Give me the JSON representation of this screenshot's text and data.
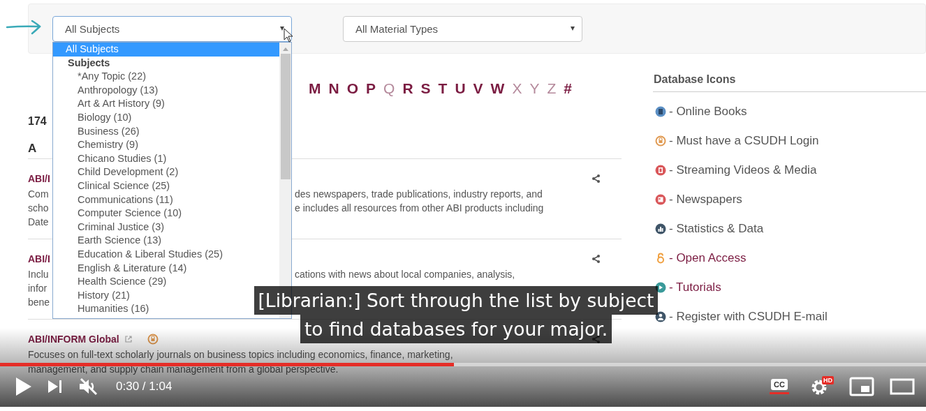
{
  "filters": {
    "subject_select": {
      "value": "All Subjects",
      "expanded": true
    },
    "material_select": {
      "value": "All Material Types"
    }
  },
  "subject_dropdown": {
    "options": [
      {
        "label": "All Subjects",
        "selected": true
      }
    ],
    "groups": [
      {
        "label": "Subjects",
        "options": [
          {
            "label": "*Any Topic (22)",
            "selected": false
          },
          {
            "label": "Anthropology (13)",
            "selected": false
          },
          {
            "label": "Art & Art History (9)",
            "selected": false
          },
          {
            "label": "Biology (10)",
            "selected": false
          },
          {
            "label": "Business (26)",
            "selected": false
          },
          {
            "label": "Chemistry (9)",
            "selected": false
          },
          {
            "label": "Chicano Studies (1)",
            "selected": false
          },
          {
            "label": "Child Development (2)",
            "selected": false
          },
          {
            "label": "Clinical Science (25)",
            "selected": false
          },
          {
            "label": "Communications (11)",
            "selected": false
          },
          {
            "label": "Computer Science (10)",
            "selected": false
          },
          {
            "label": "Criminal Justice (3)",
            "selected": false
          },
          {
            "label": "Earth Science (13)",
            "selected": false
          },
          {
            "label": "Education & Liberal Studies (25)",
            "selected": false
          },
          {
            "label": "English & Literature (14)",
            "selected": false
          },
          {
            "label": "Health Science (29)",
            "selected": false
          },
          {
            "label": "History (21)",
            "selected": false
          },
          {
            "label": "Humanities (16)",
            "selected": false
          }
        ]
      }
    ]
  },
  "alphabet": [
    {
      "letter": "M",
      "disabled": false
    },
    {
      "letter": "N",
      "disabled": false
    },
    {
      "letter": "O",
      "disabled": false
    },
    {
      "letter": "P",
      "disabled": false
    },
    {
      "letter": "Q",
      "disabled": true
    },
    {
      "letter": "R",
      "disabled": false
    },
    {
      "letter": "S",
      "disabled": false
    },
    {
      "letter": "T",
      "disabled": false
    },
    {
      "letter": "U",
      "disabled": false
    },
    {
      "letter": "V",
      "disabled": false
    },
    {
      "letter": "W",
      "disabled": false
    },
    {
      "letter": "X",
      "disabled": true
    },
    {
      "letter": "Y",
      "disabled": true
    },
    {
      "letter": "Z",
      "disabled": true
    },
    {
      "letter": "#",
      "disabled": false
    }
  ],
  "result_count": "174",
  "section_letter": "A",
  "databases": [
    {
      "title": "ABI/I",
      "description": [
        {
          "start": "Com",
          "end": "des newspapers, trade publications, industry reports, and"
        },
        {
          "start": "scho",
          "end": "e includes all resources from other ABI products including"
        },
        {
          "start": "Date"
        }
      ]
    },
    {
      "title": "ABI/I",
      "description": [
        {
          "start": "Inclu",
          "end": "cations with news about local companies, analysis,"
        },
        {
          "start": "infor"
        },
        {
          "start": "bene"
        }
      ]
    },
    {
      "title": "ABI/INFORM Global",
      "external_link": true,
      "login_required": true,
      "description": [
        {
          "text": "Focuses on full-text scholarly journals on business topics including economics, finance, marketing,"
        },
        {
          "text": "management, and supply chain management from a global perspective."
        }
      ]
    }
  ],
  "database_icons": {
    "title": "Database Icons",
    "items": [
      {
        "kind": "text",
        "color": "#5b8fc4",
        "label": "- Online Books"
      },
      {
        "kind": "text",
        "color": "#e09a52",
        "label": "- Must have a CSUDH Login"
      },
      {
        "kind": "text",
        "color": "#d9575a",
        "label": "- Streaming Videos & Media"
      },
      {
        "kind": "text",
        "color": "#d9575a",
        "label": "- Newspapers"
      },
      {
        "kind": "text",
        "color": "#3f5568",
        "label": "- Statistics & Data"
      },
      {
        "kind": "link",
        "color": "#f0a040",
        "label": "- Open Access"
      },
      {
        "kind": "link",
        "color": "#3a9a9a",
        "label": "- Tutorials"
      },
      {
        "kind": "text",
        "color": "#3f5568",
        "label": "- Register with CSUDH E-mail"
      }
    ]
  },
  "caption": [
    "[Librarian:] Sort through the list by subject",
    "to find databases for your major."
  ],
  "player": {
    "progress": {
      "level": 0.49
    },
    "time": "0:30 / 1:04",
    "muted": true,
    "captions_on": true,
    "cc_label": "CC",
    "hd_badge": "HD"
  }
}
